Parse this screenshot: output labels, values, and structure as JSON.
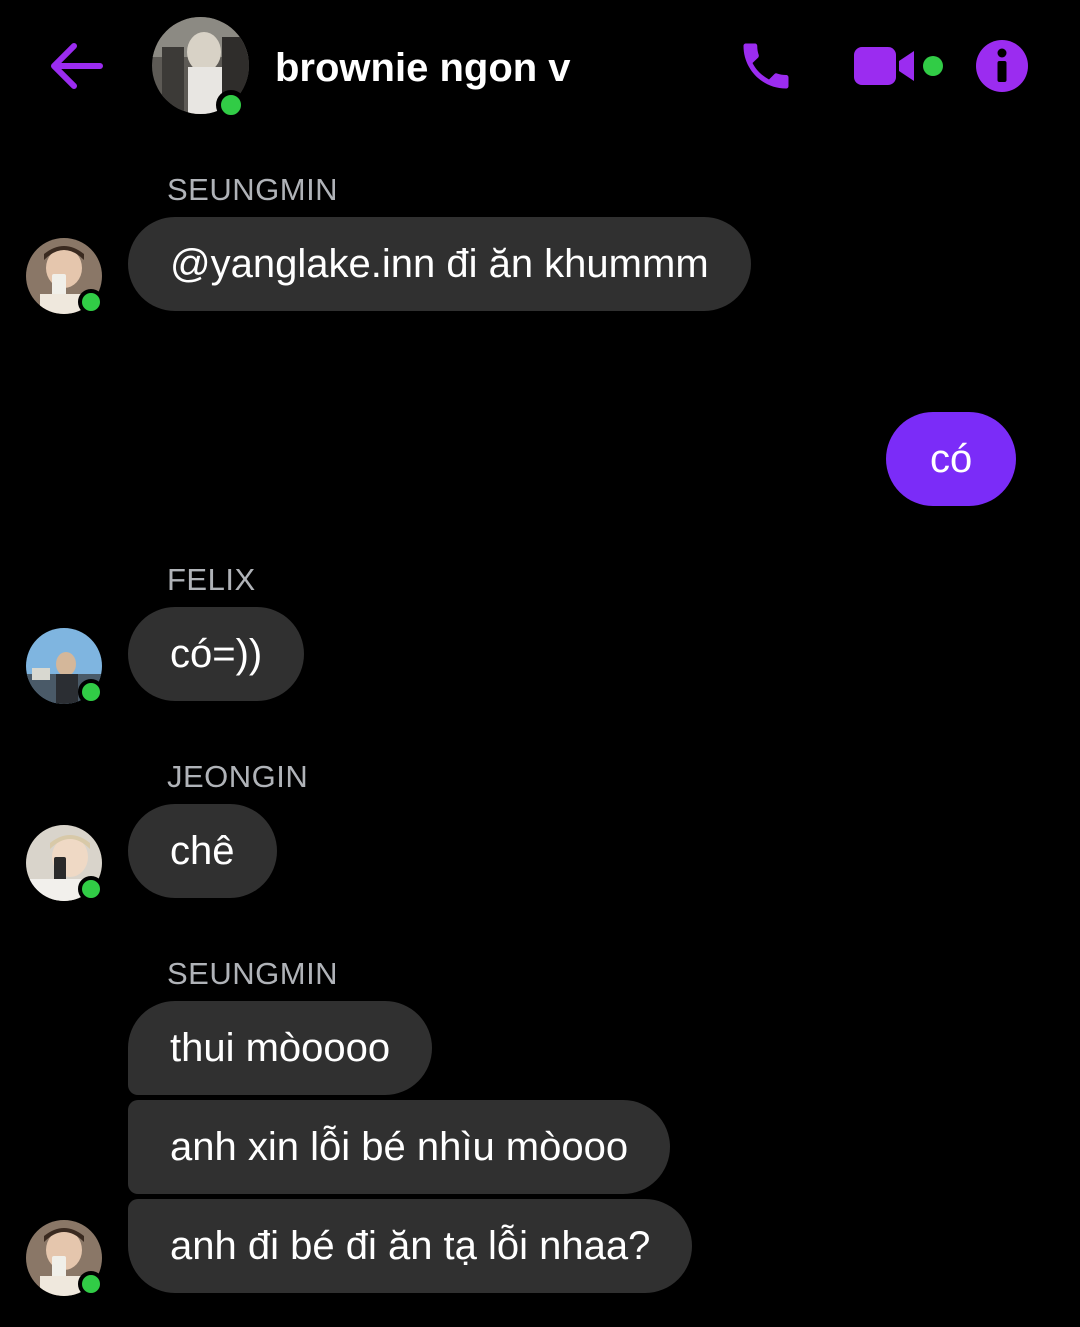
{
  "header": {
    "title": "brownie ngon v",
    "back_icon": "arrow-left-icon",
    "call_icon": "phone-icon",
    "video_icon": "video-camera-icon",
    "info_icon": "info-icon",
    "accent_color": "#9b2cf0",
    "online_color": "#31cc46"
  },
  "messages": [
    {
      "sender": "SEUNGMIN",
      "text": "@yanglake.inn đi ăn khummm"
    },
    {
      "sender": "",
      "text": "có",
      "mine": true
    },
    {
      "sender": "FELIX",
      "text": "có=))"
    },
    {
      "sender": "JEONGIN",
      "text": "chê"
    },
    {
      "sender": "SEUNGMIN",
      "texts": [
        "thui mòoooo",
        "anh xin lỗi bé nhìu mòooo",
        "anh đi bé đi ăn tạ lỗi nhaa?"
      ]
    }
  ]
}
